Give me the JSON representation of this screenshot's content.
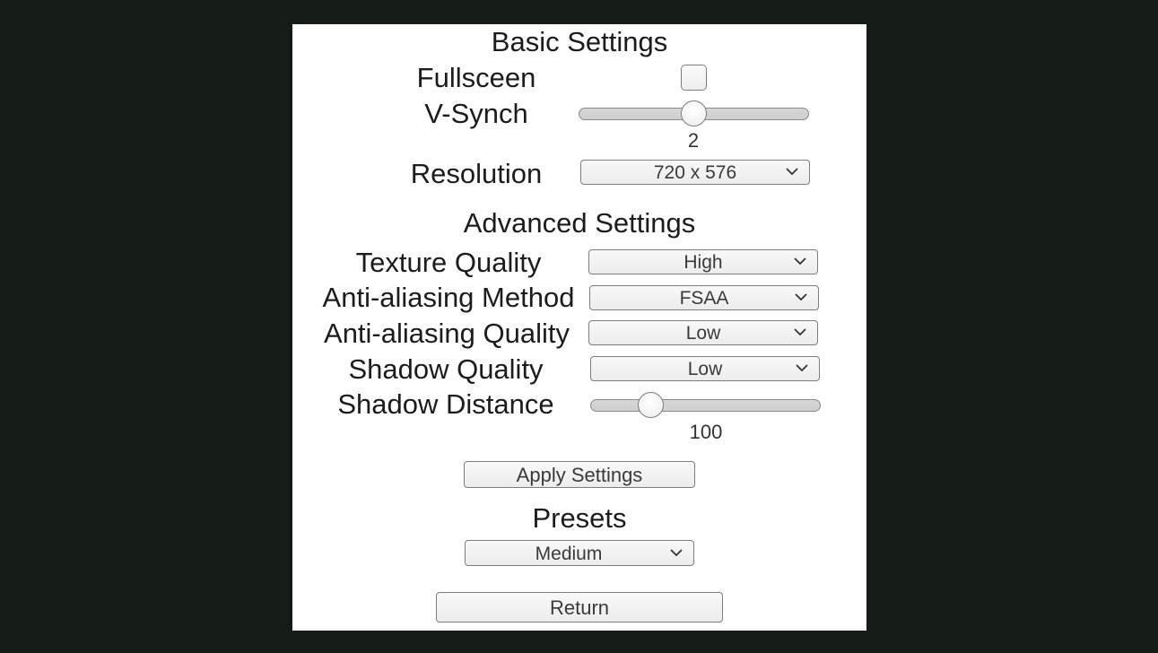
{
  "basic": {
    "heading": "Basic Settings",
    "fullscreen_label": "Fullsceen",
    "fullscreen_checked": false,
    "vsynch_label": "V-Synch",
    "vsynch_value": "2",
    "vsynch_fraction": 0.5,
    "resolution_label": "Resolution",
    "resolution_value": "720 x 576"
  },
  "advanced": {
    "heading": "Advanced Settings",
    "texture_label": "Texture Quality",
    "texture_value": "High",
    "aa_method_label": "Anti-aliasing Method",
    "aa_method_value": "FSAA",
    "aa_quality_label": "Anti-aliasing Quality",
    "aa_quality_value": "Low",
    "shadow_quality_label": "Shadow  Quality",
    "shadow_quality_value": "Low",
    "shadow_distance_label": "Shadow Distance",
    "shadow_distance_value": "100",
    "shadow_distance_fraction": 0.234
  },
  "apply_label": "Apply Settings",
  "presets": {
    "heading": "Presets",
    "value": "Medium"
  },
  "return_label": "Return"
}
